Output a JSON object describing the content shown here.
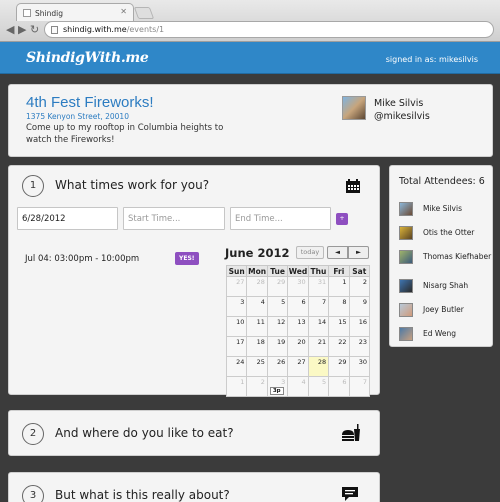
{
  "browser": {
    "tab_title": "Shindig",
    "url_host": "shindig.with.me",
    "url_path": "/events/1"
  },
  "app": {
    "logo": "ShindigWith.me",
    "signed_in": "signed in as: mikesilvis"
  },
  "event": {
    "title": "4th Fest Fireworks!",
    "address": "1375 Kenyon Street, 20010",
    "description": "Come up to my rooftop in Columbia heights to watch the Fireworks!",
    "host_name": "Mike Silvis",
    "host_handle": "@mikesilvis"
  },
  "steps": [
    {
      "number": "1",
      "title": "What times work for you?",
      "icon": "calendar-icon"
    },
    {
      "number": "2",
      "title": "And where do you like to eat?",
      "icon": "food-drink-icon"
    },
    {
      "number": "3",
      "title": "But what is this really about?",
      "icon": "speech-bubble-icon"
    }
  ],
  "time_form": {
    "date_value": "6/28/2012",
    "start_placeholder": "Start Time...",
    "end_placeholder": "End Time...",
    "add_button": "+"
  },
  "proposed_time": {
    "label": "Jul 04: 03:00pm - 10:00pm",
    "vote": "YES!"
  },
  "calendar": {
    "title": "June 2012",
    "today_label": "today",
    "prev": "◄",
    "next": "►",
    "weekdays": [
      "Sun",
      "Mon",
      "Tue",
      "Wed",
      "Thu",
      "Fri",
      "Sat"
    ],
    "weeks": [
      [
        "27",
        "28",
        "29",
        "30",
        "31",
        "1",
        "2"
      ],
      [
        "3",
        "4",
        "5",
        "6",
        "7",
        "8",
        "9"
      ],
      [
        "10",
        "11",
        "12",
        "13",
        "14",
        "15",
        "16"
      ],
      [
        "17",
        "18",
        "19",
        "20",
        "21",
        "22",
        "23"
      ],
      [
        "24",
        "25",
        "26",
        "27",
        "28",
        "29",
        "30"
      ],
      [
        "1",
        "2",
        "3",
        "4",
        "5",
        "6",
        "7"
      ]
    ],
    "event_chip": "3p"
  },
  "attendees": {
    "title": "Total Attendees: 6",
    "people": [
      "Mike Silvis",
      "Otis the Otter",
      "Thomas Kiefhaber",
      "Nisarg Shah",
      "Joey Butler",
      "Ed Weng"
    ]
  }
}
